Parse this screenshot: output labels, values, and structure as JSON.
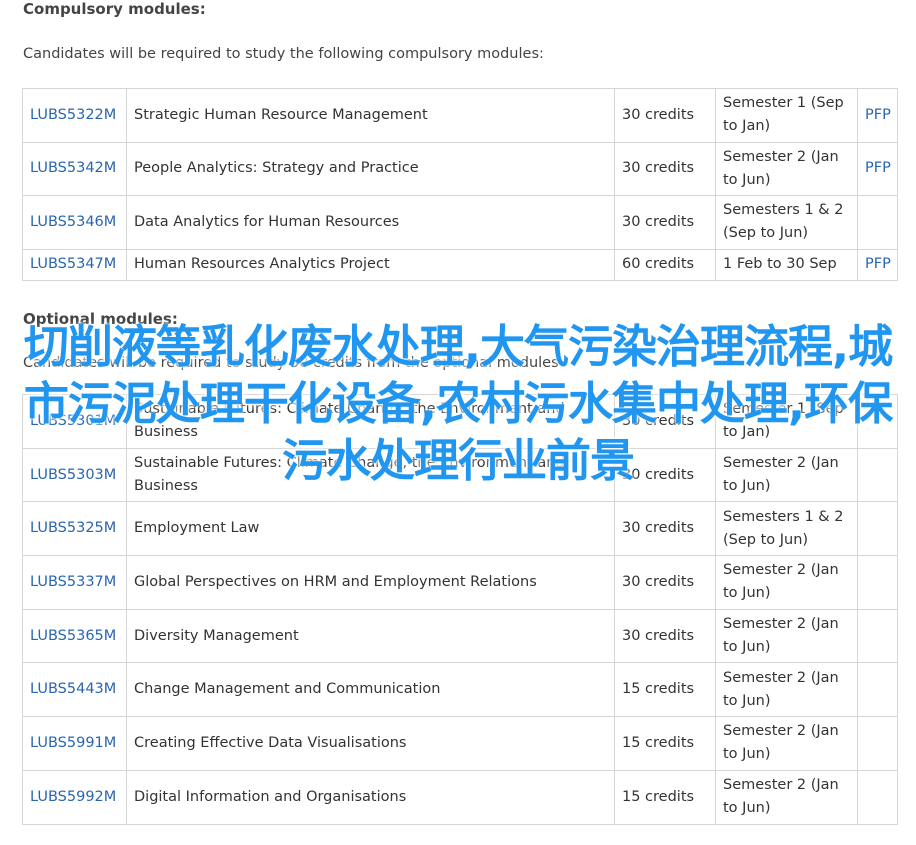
{
  "compulsory": {
    "heading": "Compulsory modules:",
    "intro": "Candidates will be required to study the following compulsory modules:",
    "rows": [
      {
        "code": "LUBS5322M",
        "title": "Strategic Human Resource Management",
        "credits": "30 credits",
        "semester": "Semester 1 (Sep to Jan)",
        "pfp": "PFP"
      },
      {
        "code": "LUBS5342M",
        "title": "People Analytics: Strategy and Practice",
        "credits": "30 credits",
        "semester": "Semester 2 (Jan to Jun)",
        "pfp": "PFP"
      },
      {
        "code": "LUBS5346M",
        "title": "Data Analytics for Human Resources",
        "credits": "30 credits",
        "semester": "Semesters 1 & 2 (Sep to Jun)",
        "pfp": ""
      },
      {
        "code": "LUBS5347M",
        "title": "Human Resources Analytics Project",
        "credits": "60 credits",
        "semester": "1 Feb to 30 Sep",
        "pfp": "PFP"
      }
    ]
  },
  "optional": {
    "heading": "Optional modules:",
    "intro": "Candidates will be required to study 30 credits from the optional modules",
    "rows": [
      {
        "code": "LUBS5301M",
        "title": "Sustainable Futures: Climate Change, the Environment and Business",
        "credits": "30 credits",
        "semester": "Semester 1 (Sep to Jan)",
        "pfp": ""
      },
      {
        "code": "LUBS5303M",
        "title": "Sustainable Futures: Climate Change, the Environment and Business",
        "credits": "30 credits",
        "semester": "Semester 2 (Jan to Jun)",
        "pfp": ""
      },
      {
        "code": "LUBS5325M",
        "title": "Employment Law",
        "credits": "30 credits",
        "semester": "Semesters 1 & 2 (Sep to Jun)",
        "pfp": ""
      },
      {
        "code": "LUBS5337M",
        "title": "Global Perspectives on HRM and Employment Relations",
        "credits": "30 credits",
        "semester": "Semester 2 (Jan to Jun)",
        "pfp": ""
      },
      {
        "code": "LUBS5365M",
        "title": "Diversity Management",
        "credits": "30 credits",
        "semester": "Semester 2 (Jan to Jun)",
        "pfp": ""
      },
      {
        "code": "LUBS5443M",
        "title": "Change Management and Communication",
        "credits": "15 credits",
        "semester": "Semester 2 (Jan to Jun)",
        "pfp": ""
      },
      {
        "code": "LUBS5991M",
        "title": "Creating Effective Data Visualisations",
        "credits": "15 credits",
        "semester": "Semester 2 (Jan to Jun)",
        "pfp": ""
      },
      {
        "code": "LUBS5992M",
        "title": "Digital Information and Organisations",
        "credits": "15 credits",
        "semester": "Semester 2 (Jan to Jun)",
        "pfp": ""
      }
    ]
  },
  "overlay": {
    "text": "切削液等乳化废水处理,大气污染治理流程,城市污泥处理干化设备,农村污水集中处理,环保污水处理行业前景"
  }
}
